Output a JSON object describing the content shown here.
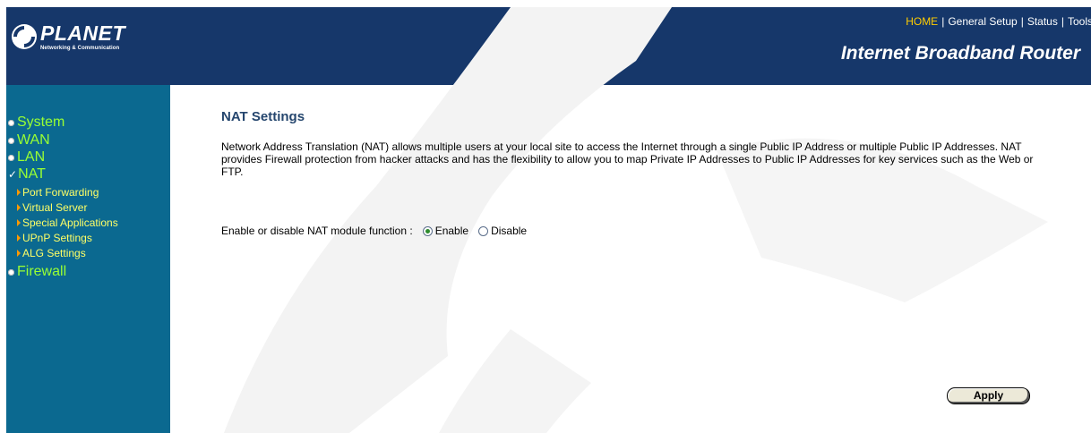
{
  "header": {
    "logo_text": "PLANET",
    "logo_subtext": "Networking & Communication",
    "title": "Internet Broadband Router",
    "topnav": [
      {
        "label": "HOME",
        "active": true
      },
      {
        "label": "General Setup",
        "active": false
      },
      {
        "label": "Status",
        "active": false
      },
      {
        "label": "Tools",
        "active": false
      }
    ]
  },
  "sidebar": {
    "items": [
      {
        "label": "System",
        "icon": "bullet-icon"
      },
      {
        "label": "WAN",
        "icon": "bullet-icon"
      },
      {
        "label": "LAN",
        "icon": "bullet-icon"
      },
      {
        "label": "NAT",
        "icon": "check-icon",
        "expanded": true
      },
      {
        "label": "Firewall",
        "icon": "bullet-icon"
      }
    ],
    "nat_subitems": [
      {
        "label": "Port Forwarding"
      },
      {
        "label": "Virtual Server"
      },
      {
        "label": "Special Applications"
      },
      {
        "label": "UPnP Settings"
      },
      {
        "label": "ALG Settings"
      }
    ]
  },
  "main": {
    "title": "NAT Settings",
    "description": "Network Address Translation (NAT) allows multiple users at your local site to access the Internet through a single Public IP Address or multiple Public IP Addresses. NAT provides Firewall protection from hacker attacks and has the flexibility to allow you to map Private IP Addresses to Public IP Addresses for key services such as the Web or FTP.",
    "nat_label": "Enable or disable NAT module function :",
    "nat_options": [
      {
        "label": "Enable",
        "selected": true
      },
      {
        "label": "Disable",
        "selected": false
      }
    ],
    "apply_label": "Apply"
  },
  "colors": {
    "header_bg": "#16376a",
    "sidebar_bg": "#0b6990",
    "menu_text": "#99ff33",
    "submenu_text": "#ffff66",
    "nav_active": "#ffcc00",
    "title_text": "#25466e"
  }
}
